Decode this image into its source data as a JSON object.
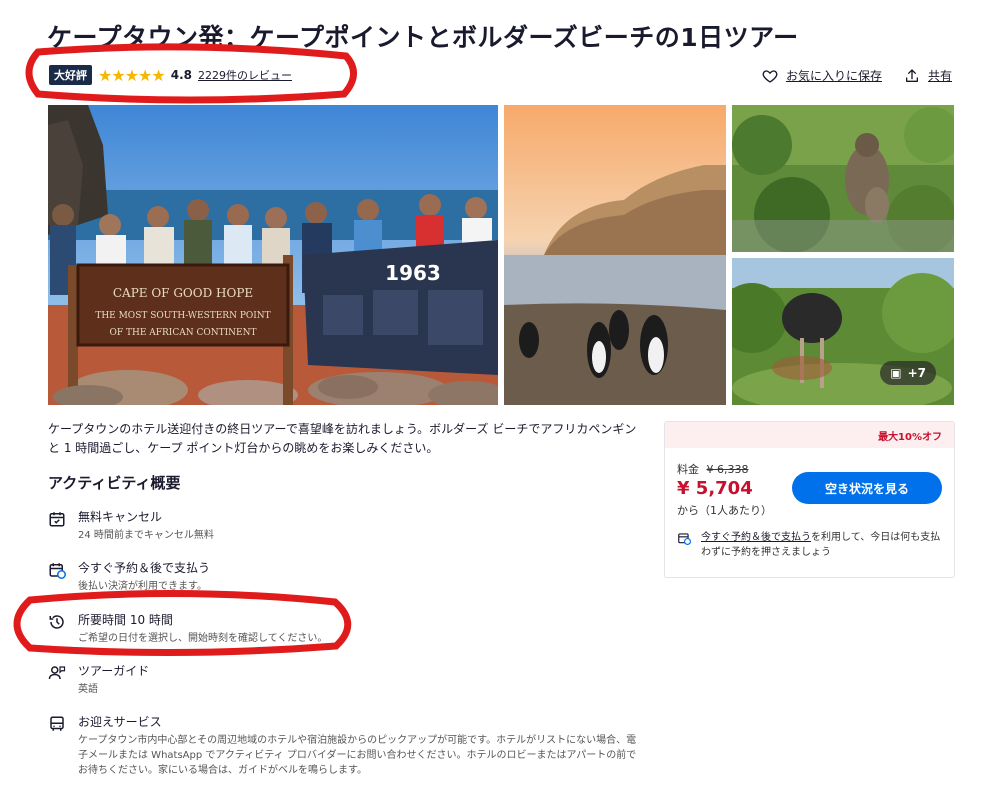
{
  "header": {
    "title": "ケープタウン発：ケープポイントとボルダーズビーチの1日ツアー",
    "badge": "大好評",
    "score": "4.8",
    "reviews": "2229件のレビュー",
    "favorite": "お気に入りに保存",
    "share": "共有"
  },
  "gallery": {
    "main_sign_line1": "CAPE OF GOOD HOPE",
    "main_sign_line2": "THE MOST SOUTH-WESTERN POINT",
    "main_sign_line3": "OF THE AFRICAN CONTINENT",
    "banner_year": "1963",
    "more_label": "+7"
  },
  "description": "ケープタウンのホテル送迎付きの終日ツアーで喜望峰を訪れましょう。ボルダーズ ビーチでアフリカペンギンと 1 時間過ごし、ケープ ポイント灯台からの眺めをお楽しみください。",
  "overview": {
    "title": "アクティビティ概要",
    "items": [
      {
        "title": "無料キャンセル",
        "sub": "24 時間前までキャンセル無料",
        "icon": "calendar-check-icon"
      },
      {
        "title": "今すぐ予約＆後で支払う",
        "sub": "後払い決済が利用できます。",
        "icon": "calendar-clock-icon"
      },
      {
        "title": "所要時間 10 時間",
        "sub": "ご希望の日付を選択し、開始時刻を確認してください。",
        "icon": "history-clock-icon"
      },
      {
        "title": "ツアーガイド",
        "sub": "英語",
        "icon": "guide-person-icon"
      },
      {
        "title": "お迎えサービス",
        "sub": "ケープタウン市内中心部とその周辺地域のホテルや宿泊施設からのピックアップが可能です。ホテルがリストにない場合、電子メールまたは WhatsApp でアクティビティ プロバイダーにお問い合わせください。ホテルのロビーまたはアパートの前でお待ちください。家にいる場合は、ガイドがベルを鳴らします。",
        "icon": "bus-icon"
      }
    ]
  },
  "price_card": {
    "discount": "最大10%オフ",
    "price_label": "料金",
    "old_price": "¥ 6,338",
    "new_price": "¥ 5,704",
    "unit": "から（1人あたり）",
    "cta": "空き状況を見る",
    "paylater_link": "今すぐ予約＆後で支払う",
    "paylater_text": "を利用して、今日は何も支払わずに予約を押さえましょう"
  },
  "colors": {
    "accent": "#0071eb",
    "price_red": "#c8102e",
    "star": "#f5b700",
    "annotation_red": "#e01b1b"
  }
}
